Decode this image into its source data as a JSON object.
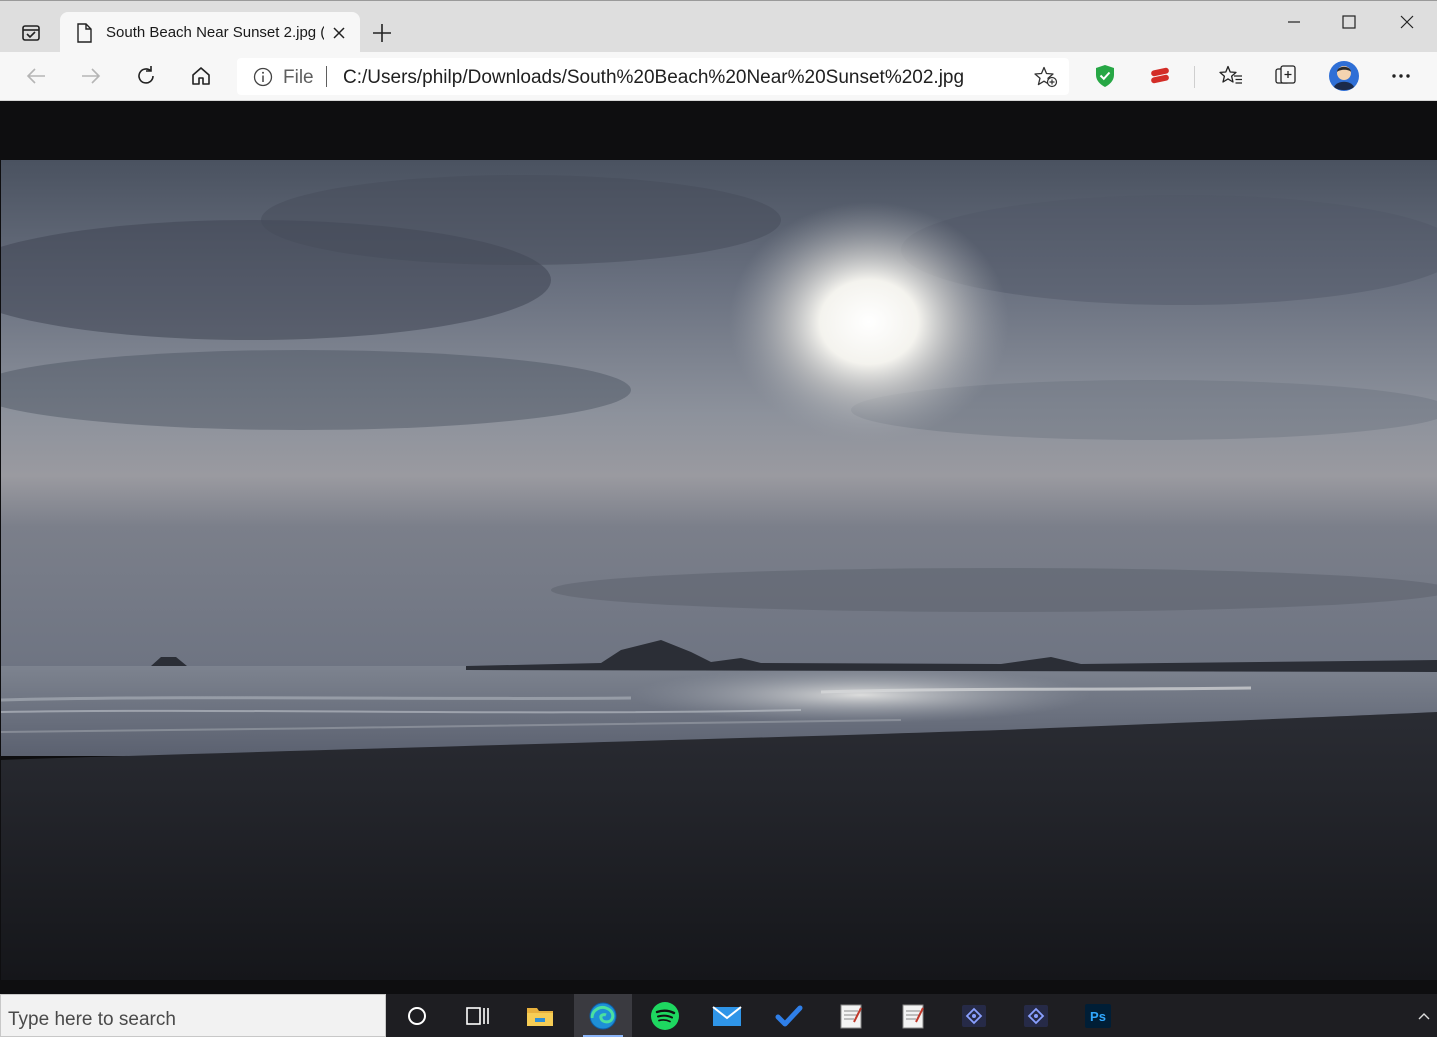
{
  "tab": {
    "title": "South Beach Near Sunset 2.jpg ("
  },
  "address": {
    "scheme": "File",
    "url": "C:/Users/philp/Downloads/South%20Beach%20Near%20Sunset%202.jpg"
  },
  "taskbar": {
    "search_placeholder": "Type here to search"
  },
  "icons": [
    "tab-actions-icon",
    "document-icon",
    "close-icon",
    "plus-icon",
    "minimize-icon",
    "maximize-icon",
    "window-close-icon",
    "back-arrow-icon",
    "forward-arrow-icon",
    "refresh-icon",
    "home-icon",
    "info-icon",
    "add-favorite-icon",
    "shield-extension-icon",
    "lastpass-extension-icon",
    "favorites-icon",
    "collections-icon",
    "profile-avatar",
    "more-icon",
    "cortana-icon",
    "task-view-icon",
    "file-explorer-icon",
    "edge-icon",
    "spotify-icon",
    "mail-icon",
    "todo-icon",
    "photoshop-icon"
  ],
  "colors": {
    "accent": "#8ab4f8",
    "spotify": "#1ed760",
    "shield": "#27a745",
    "lastpass": "#d32d27",
    "photoshop": "#31a8ff"
  }
}
